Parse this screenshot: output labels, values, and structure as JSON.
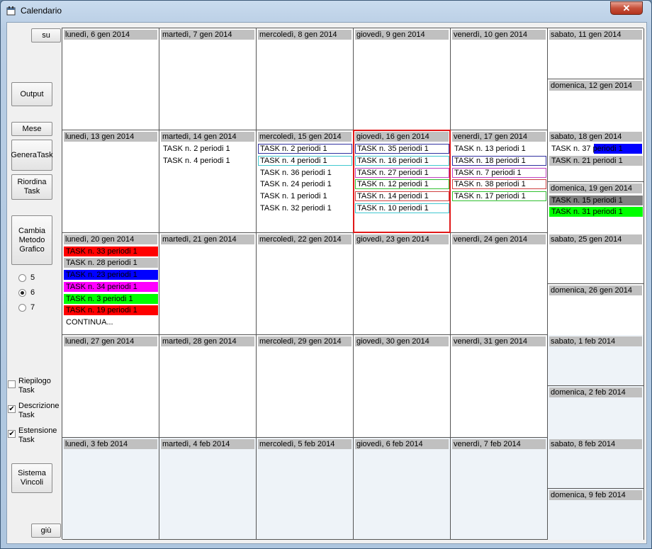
{
  "window": {
    "title": "Calendario",
    "close_label": "✕"
  },
  "sidebar": {
    "up_label": "su",
    "output_label": "Output",
    "month_label": "Mese",
    "generate_label": "GeneraTask",
    "reorder_label": "Riordina Task",
    "change_method_label": "Cambia Metodo Grafico",
    "radios": [
      {
        "label": "5",
        "checked": false
      },
      {
        "label": "6",
        "checked": true
      },
      {
        "label": "7",
        "checked": false
      }
    ],
    "checks": [
      {
        "label": "Riepilogo Task",
        "checked": false
      },
      {
        "label": "Descrizione Task",
        "checked": true
      },
      {
        "label": "Estensione Task",
        "checked": true
      }
    ],
    "constraints_label": "Sistema Vincoli",
    "down_label": "giù"
  },
  "colors": {
    "red": "#ff0000",
    "blue": "#0000ff",
    "magenta": "#ff00ff",
    "green": "#00ff00",
    "gray": "#c0c0c0",
    "darkgray": "#808080",
    "next_month_bg": "#eef3f8"
  },
  "weeks": [
    {
      "days": [
        {
          "label": "lunedì, 6 gen 2014",
          "tasks": []
        },
        {
          "label": "martedì, 7 gen 2014",
          "tasks": []
        },
        {
          "label": "mercoledì, 8 gen 2014",
          "tasks": []
        },
        {
          "label": "giovedì, 9 gen 2014",
          "tasks": []
        },
        {
          "label": "venerdì, 10 gen 2014",
          "tasks": []
        }
      ],
      "sat": {
        "label": "sabato, 11 gen 2014",
        "tasks": []
      },
      "sun": {
        "label": "domenica, 12 gen 2014",
        "tasks": []
      }
    },
    {
      "days": [
        {
          "label": "lunedì, 13 gen 2014",
          "tasks": []
        },
        {
          "label": "martedì, 14 gen 2014",
          "tasks": [
            {
              "text": "TASK n. 2 periodi 1"
            },
            {
              "text": "TASK n. 4 periodi 1"
            }
          ]
        },
        {
          "label": "mercoledì, 15 gen 2014",
          "tasks": [
            {
              "text": "TASK n. 2 periodi 1",
              "border": "#3030a0"
            },
            {
              "text": "TASK n. 4 periodi 1",
              "border": "#40c8d0"
            },
            {
              "text": "TASK n. 36 periodi 1"
            },
            {
              "text": "TASK n. 24 periodi 1"
            },
            {
              "text": "TASK n. 1 periodi 1"
            },
            {
              "text": "TASK n. 32 periodi 1"
            }
          ]
        },
        {
          "label": "giovedì, 16 gen 2014",
          "highlight": true,
          "tasks": [
            {
              "text": "TASK n. 35 periodi 1",
              "border": "#3030a0"
            },
            {
              "text": "TASK n. 16 periodi 1",
              "border": "#40c8d0"
            },
            {
              "text": "TASK n. 27 periodi 1",
              "border": "#c040c0"
            },
            {
              "text": "TASK n. 12 periodi 1",
              "border": "#30c030"
            },
            {
              "text": "TASK n. 14 periodi 1",
              "border": "#d04040"
            },
            {
              "text": "TASK n. 10 periodi 1",
              "border": "#40c8d0"
            }
          ]
        },
        {
          "label": "venerdì, 17 gen 2014",
          "tasks": [
            {
              "text": "TASK n. 13 periodi 1"
            },
            {
              "text": "TASK n. 18 periodi 1",
              "border": "#3030a0"
            },
            {
              "text": "TASK n. 7 periodi 1",
              "border": "#c040c0"
            },
            {
              "text": "TASK n. 38 periodi 1",
              "border": "#d04040"
            },
            {
              "text": "TASK n. 17 periodi 1",
              "border": "#30c030"
            }
          ]
        }
      ],
      "sat": {
        "label": "sabato, 18 gen 2014",
        "tasks": [
          {
            "text": "TASK n. 37 periodi 1",
            "bar": "#0000ff"
          },
          {
            "text": "TASK n. 21 periodi 1",
            "fill": "#c0c0c0"
          }
        ]
      },
      "sun": {
        "label": "domenica, 19 gen 2014",
        "tasks": [
          {
            "text": "TASK n. 15 periodi 1",
            "fill": "#808080"
          },
          {
            "text": "TASK n. 31 periodi 1",
            "fill": "#00ff00"
          }
        ]
      }
    },
    {
      "days": [
        {
          "label": "lunedì, 20 gen 2014",
          "tasks": [
            {
              "text": "TASK n. 33 periodi 1",
              "fill": "#ff0000"
            },
            {
              "text": "TASK n. 28 periodi 1",
              "fill": "#c0c0c0"
            },
            {
              "text": "TASK n. 23 periodi 1",
              "fill": "#0000ff"
            },
            {
              "text": "TASK n. 34 periodi 1",
              "fill": "#ff00ff"
            },
            {
              "text": "TASK n. 3 periodi 1",
              "fill": "#00ff00"
            },
            {
              "text": "TASK n. 19 periodi 1",
              "fill": "#ff0000"
            },
            {
              "text": "CONTINUA..."
            }
          ]
        },
        {
          "label": "martedì, 21 gen 2014",
          "tasks": []
        },
        {
          "label": "mercoledì, 22 gen 2014",
          "tasks": []
        },
        {
          "label": "giovedì, 23 gen 2014",
          "tasks": []
        },
        {
          "label": "venerdì, 24 gen 2014",
          "tasks": []
        }
      ],
      "sat": {
        "label": "sabato, 25 gen 2014",
        "tasks": []
      },
      "sun": {
        "label": "domenica, 26 gen 2014",
        "tasks": []
      }
    },
    {
      "days": [
        {
          "label": "lunedì, 27 gen 2014",
          "tasks": []
        },
        {
          "label": "martedì, 28 gen 2014",
          "tasks": []
        },
        {
          "label": "mercoledì, 29 gen 2014",
          "tasks": []
        },
        {
          "label": "giovedì, 30 gen 2014",
          "tasks": []
        },
        {
          "label": "venerdì, 31 gen 2014",
          "tasks": []
        }
      ],
      "sat": {
        "label": "sabato, 1 feb 2014",
        "tasks": [],
        "next": true
      },
      "sun": {
        "label": "domenica, 2 feb 2014",
        "tasks": [],
        "next": true
      }
    },
    {
      "days": [
        {
          "label": "lunedì, 3 feb 2014",
          "tasks": [],
          "next": true
        },
        {
          "label": "martedì, 4 feb 2014",
          "tasks": [],
          "next": true
        },
        {
          "label": "mercoledì, 5 feb 2014",
          "tasks": [],
          "next": true
        },
        {
          "label": "giovedì, 6 feb 2014",
          "tasks": [],
          "next": true
        },
        {
          "label": "venerdì, 7 feb 2014",
          "tasks": [],
          "next": true
        }
      ],
      "sat": {
        "label": "sabato, 8 feb 2014",
        "tasks": [],
        "next": true
      },
      "sun": {
        "label": "domenica, 9 feb 2014",
        "tasks": [],
        "next": true
      }
    }
  ]
}
